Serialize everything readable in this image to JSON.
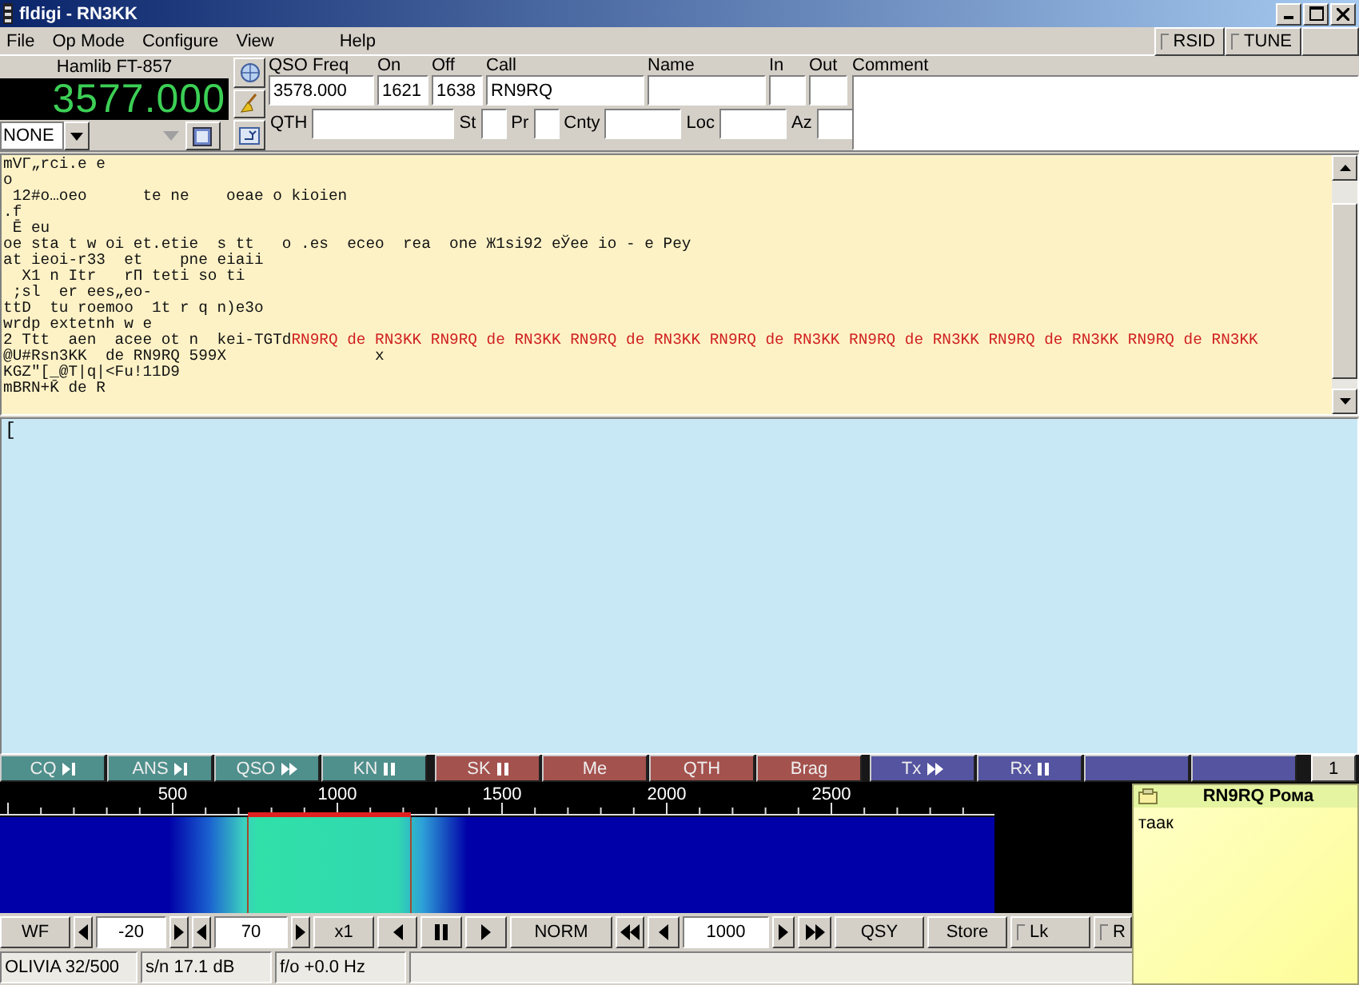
{
  "window": {
    "title": "fldigi - RN3KK"
  },
  "menu": [
    "File",
    "Op Mode",
    "Configure",
    "View",
    "Help"
  ],
  "toggles": [
    {
      "label": "RSID",
      "on": false
    },
    {
      "label": "TUNE",
      "on": false
    }
  ],
  "rig": {
    "name": "Hamlib FT-857",
    "frequency": "3577.000",
    "mode": "NONE"
  },
  "log": {
    "top": [
      {
        "label": "QSO Freq",
        "value": "3578.000"
      },
      {
        "label": "On",
        "value": "1621"
      },
      {
        "label": "Off",
        "value": "1638"
      },
      {
        "label": "Call",
        "value": "RN9RQ"
      },
      {
        "label": "Name"
      },
      {
        "label": "In"
      },
      {
        "label": "Out"
      }
    ],
    "bottom": [
      {
        "label": "QTH"
      },
      {
        "label": "St"
      },
      {
        "label": "Pr"
      },
      {
        "label": "Cnty"
      },
      {
        "label": "Loc"
      },
      {
        "label": "Az"
      }
    ],
    "comment_label": "Comment"
  },
  "rx_text": [
    [
      {
        "kind": "rx",
        "text": "mVΓ„rci.e e"
      }
    ],
    [
      {
        "kind": "rx",
        "text": "o"
      }
    ],
    [
      {
        "kind": "rx",
        "text": " 12#o…oeo      te ne    oeae o kioien"
      }
    ],
    [
      {
        "kind": "rx",
        "text": ".f"
      }
    ],
    [
      {
        "kind": "rx",
        "text": " Ē eu"
      }
    ],
    [
      {
        "kind": "rx",
        "text": "oe sta t w oi et.etie  s tt   o .es  eceo  rea  one Ж1si92 eЎee io - e Pey"
      }
    ],
    [
      {
        "kind": "rx",
        "text": "at ieoi-r33  et    pne eiaii"
      }
    ],
    [
      {
        "kind": "rx",
        "text": "  X1 n Itr   rП teti so ti"
      }
    ],
    [
      {
        "kind": "rx",
        "text": " ;sl  er ees„eo-"
      }
    ],
    [
      {
        "kind": "rx",
        "text": "ttD  tu roemoo  1t r q n)e3o"
      }
    ],
    [
      {
        "kind": "rx",
        "text": "wrdp extetnh w e"
      }
    ],
    [
      {
        "kind": "rx",
        "text": "2 Ttt  aen  acee ot n  kei-TGTd"
      },
      {
        "kind": "tx",
        "text": "RN9RQ de RN3KK RN9RQ de RN3KK RN9RQ de RN3KK RN9RQ de RN3KK RN9RQ de RN3KK RN9RQ de RN3KK RN9RQ de RN3KK"
      }
    ],
    [
      {
        "kind": "rx",
        "text": "@U#Rsn3KK  de RN9RQ 599X                x"
      }
    ],
    [
      {
        "kind": "rx",
        "text": "KGZ\"[_@T|q|<Fu!11D9"
      }
    ],
    [
      {
        "kind": "rx",
        "text": "mBRN+K̄ de R"
      }
    ]
  ],
  "tx_text": "[",
  "macros": [
    {
      "kind": "skip",
      "label": "CQ",
      "color": "#4f8f8c"
    },
    {
      "kind": "skip",
      "label": "ANS",
      "color": "#4f8f8c"
    },
    {
      "kind": "forward",
      "label": "QSO",
      "color": "#4f8f8c"
    },
    {
      "kind": "pause",
      "label": "KN",
      "color": "#4f8f8c"
    },
    {
      "kind": "pause",
      "label": "SK",
      "color": "#a4524e"
    },
    {
      "kind": "plain",
      "label": "Me",
      "color": "#a4524e"
    },
    {
      "kind": "plain",
      "label": "QTH",
      "color": "#a4524e"
    },
    {
      "kind": "plain",
      "label": "Brag",
      "color": "#a4524e"
    },
    {
      "kind": "forward",
      "label": "Tx",
      "color": "#5454a0"
    },
    {
      "kind": "pause",
      "label": "Rx",
      "color": "#5454a0"
    },
    {
      "kind": "plain",
      "color": "#5454a0"
    },
    {
      "kind": "plain",
      "color": "#5454a0"
    }
  ],
  "macro_page": "1",
  "scale_labels": [
    "500",
    "1000",
    "1500",
    "2000",
    "2500"
  ],
  "controls": [
    {
      "kind": "button",
      "label": "WF"
    },
    {
      "kind": "arrow-left"
    },
    {
      "kind": "field",
      "value": "-20"
    },
    {
      "kind": "arrow-right"
    },
    {
      "kind": "arrow-left"
    },
    {
      "kind": "field",
      "value": "70"
    },
    {
      "kind": "arrow-right"
    },
    {
      "kind": "button",
      "label": "x1"
    },
    {
      "kind": "arrow-left"
    },
    {
      "kind": "pause"
    },
    {
      "kind": "arrow-right"
    },
    {
      "kind": "button",
      "label": "NORM"
    },
    {
      "kind": "rewind"
    },
    {
      "kind": "arrow-left"
    },
    {
      "kind": "field",
      "value": "1000"
    },
    {
      "kind": "arrow-right"
    },
    {
      "kind": "fast-forward"
    },
    {
      "kind": "button",
      "label": "QSY"
    },
    {
      "kind": "button",
      "label": "Store"
    },
    {
      "kind": "checkbox",
      "label": "Lk",
      "checked": false
    },
    {
      "kind": "checkbox",
      "label": "R",
      "checked": false
    }
  ],
  "status": [
    "OLIVIA 32/500",
    "s/n 17.1 dB",
    "f/o +0.0 Hz"
  ],
  "note": {
    "title": "RN9RQ Рома",
    "text": "таак"
  }
}
